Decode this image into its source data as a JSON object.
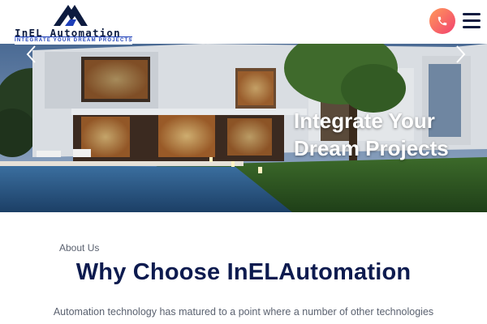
{
  "header": {
    "logo_title": "InEL Automation",
    "logo_tagline": "INTEGRATE YOUR DREAM PROJECTS",
    "phone_icon": "phone-icon",
    "menu_icon": "hamburger-menu-icon"
  },
  "hero": {
    "title": "Integrate Your Dream Projects",
    "prev_icon": "chevron-left-icon",
    "next_icon": "chevron-right-icon"
  },
  "about": {
    "label": "About Us",
    "title": "Why Choose InELAutomation",
    "text": "Automation technology has matured to a point where a number of other technologies"
  },
  "colors": {
    "navy": "#0d1b4f",
    "tagline_blue": "#1d3fb8",
    "phone_gradient_start": "#ff9a5a",
    "phone_gradient_end": "#f2416f",
    "body_gray": "#5b6270"
  }
}
